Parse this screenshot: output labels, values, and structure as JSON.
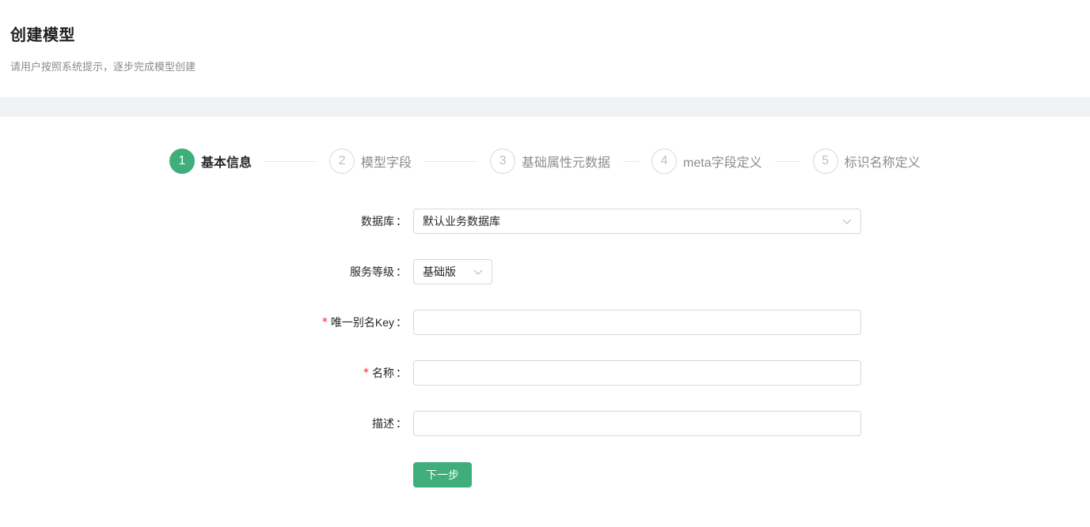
{
  "header": {
    "title": "创建模型",
    "subtitle": "请用户按照系统提示，逐步完成模型创建"
  },
  "steps": [
    {
      "number": "1",
      "title": "基本信息",
      "status": "active"
    },
    {
      "number": "2",
      "title": "模型字段",
      "status": "wait"
    },
    {
      "number": "3",
      "title": "基础属性元数据",
      "status": "wait"
    },
    {
      "number": "4",
      "title": "meta字段定义",
      "status": "wait"
    },
    {
      "number": "5",
      "title": "标识名称定义",
      "status": "wait"
    }
  ],
  "form": {
    "database": {
      "label": "数据库",
      "value": "默认业务数据库",
      "required": false
    },
    "service_level": {
      "label": "服务等级",
      "value": "基础版",
      "required": false
    },
    "alias_key": {
      "label": "唯一别名Key",
      "value": "",
      "required": true
    },
    "name": {
      "label": "名称",
      "value": "",
      "required": true
    },
    "description": {
      "label": "描述",
      "value": "",
      "required": false
    },
    "colon": "："
  },
  "actions": {
    "next_label": "下一步"
  },
  "colors": {
    "primary": "#3fae7b",
    "required": "#f5222d",
    "band": "#f0f2f5"
  },
  "icons": {
    "select_arrow": "chevron-down-icon"
  }
}
